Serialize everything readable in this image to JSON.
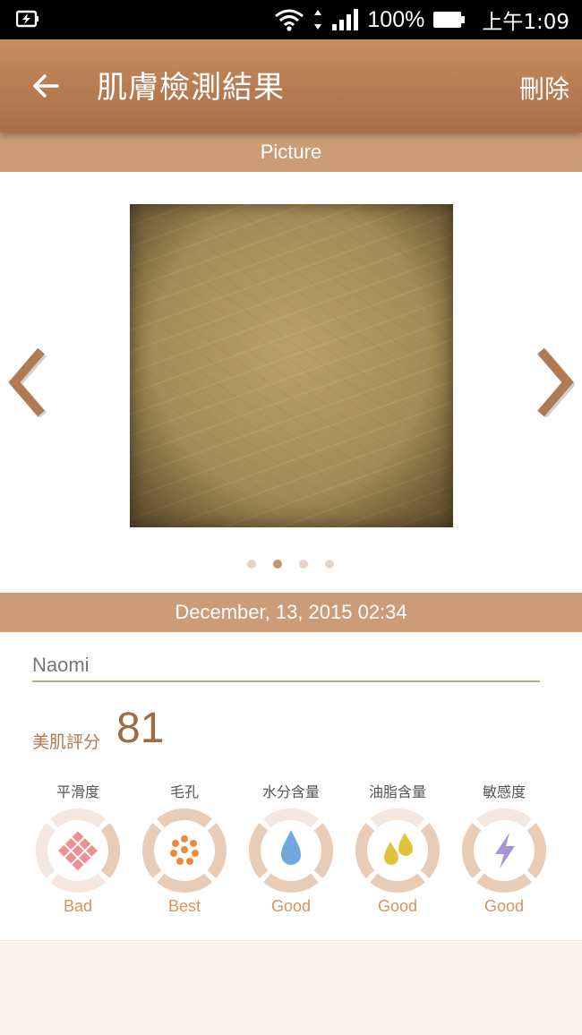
{
  "status_bar": {
    "battery_percent": "100%",
    "time": "上午1:09"
  },
  "app_bar": {
    "title": "肌膚檢測結果",
    "delete_label": "刪除"
  },
  "picture_section": {
    "label": "Picture",
    "page_count": 4,
    "active_page": 2
  },
  "date_bar": {
    "text": "December, 13, 2015 02:34"
  },
  "profile": {
    "name": "Naomi"
  },
  "score": {
    "label": "美肌評分",
    "value": "81"
  },
  "metrics": [
    {
      "label": "平滑度",
      "status": "Bad",
      "icon": "grid-diamond-icon",
      "level": 0.25
    },
    {
      "label": "毛孔",
      "status": "Best",
      "icon": "pores-dots-icon",
      "level": 1.0
    },
    {
      "label": "水分含量",
      "status": "Good",
      "icon": "water-drop-icon",
      "level": 0.75
    },
    {
      "label": "油脂含量",
      "status": "Good",
      "icon": "oil-drops-icon",
      "level": 0.75
    },
    {
      "label": "敏感度",
      "status": "Good",
      "icon": "lightning-icon",
      "level": 0.75
    }
  ],
  "colors": {
    "brand": "#b67b51",
    "section_bar": "#cc9b77",
    "status_text": "#d5935f",
    "ring_filled": "#e8ccb5",
    "ring_empty": "#f5e7dd"
  }
}
